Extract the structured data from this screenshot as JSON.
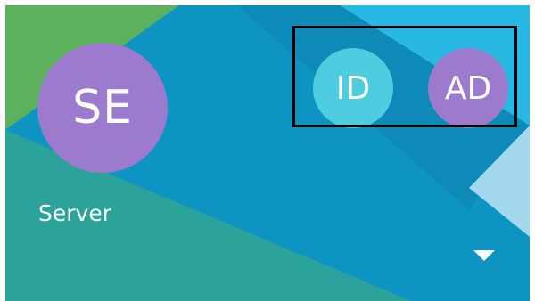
{
  "drawer_header": {
    "colors": {
      "teal": "#2ba29a",
      "green": "#5bb15c",
      "blue_dark": "#0d8ab8",
      "blue_mid": "#0e94c2",
      "blue_light": "#27b9e4",
      "blue_pale": "#a4d8ef"
    },
    "current_account": {
      "initials": "SE",
      "name": "Server",
      "avatar_color": "#9c7bcf"
    },
    "other_accounts": [
      {
        "initials": "ID",
        "avatar_color": "#4fcde0"
      },
      {
        "initials": "AD",
        "avatar_color": "#9c7bcf"
      }
    ],
    "account_switch_icon": "arrow-drop-down-icon",
    "highlight_color": "#000000"
  }
}
